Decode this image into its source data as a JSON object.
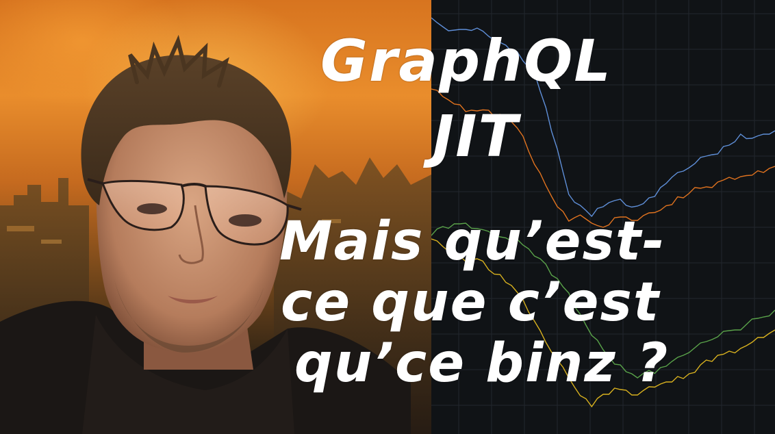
{
  "thumbnail": {
    "title_lines": [
      "GraphQL",
      "JIT",
      "Mais qu’est-",
      "ce que c’est",
      "qu’ce binz ?"
    ]
  },
  "chart_data": {
    "type": "line",
    "series": [
      {
        "color": "#5f8fd8",
        "values": [
          30,
          42,
          46,
          44,
          41,
          52,
          60,
          72,
          85,
          110,
          160,
          220,
          285,
          300,
          315,
          300,
          290,
          296,
          305,
          292,
          276,
          260,
          250,
          238,
          226,
          222,
          208,
          200,
          205,
          198,
          192
        ]
      },
      {
        "color": "#e1731f",
        "values": [
          130,
          140,
          150,
          160,
          158,
          165,
          170,
          180,
          200,
          240,
          270,
          300,
          320,
          310,
          330,
          335,
          320,
          318,
          322,
          310,
          305,
          296,
          285,
          278,
          276,
          268,
          260,
          258,
          255,
          250,
          240
        ]
      },
      {
        "color": "#5aa34a",
        "values": [
          340,
          335,
          330,
          328,
          335,
          338,
          345,
          350,
          355,
          370,
          390,
          410,
          430,
          460,
          490,
          510,
          530,
          540,
          548,
          545,
          540,
          530,
          520,
          508,
          498,
          490,
          480,
          478,
          470,
          466,
          455
        ]
      },
      {
        "color": "#d9b21f",
        "values": [
          350,
          360,
          372,
          380,
          375,
          390,
          405,
          420,
          440,
          470,
          500,
          525,
          550,
          575,
          590,
          580,
          570,
          572,
          578,
          565,
          560,
          556,
          550,
          540,
          530,
          522,
          515,
          510,
          500,
          492,
          480
        ]
      }
    ],
    "grid": true
  },
  "colors": {
    "background_dark": "#101316",
    "title_text": "#ffffff"
  }
}
